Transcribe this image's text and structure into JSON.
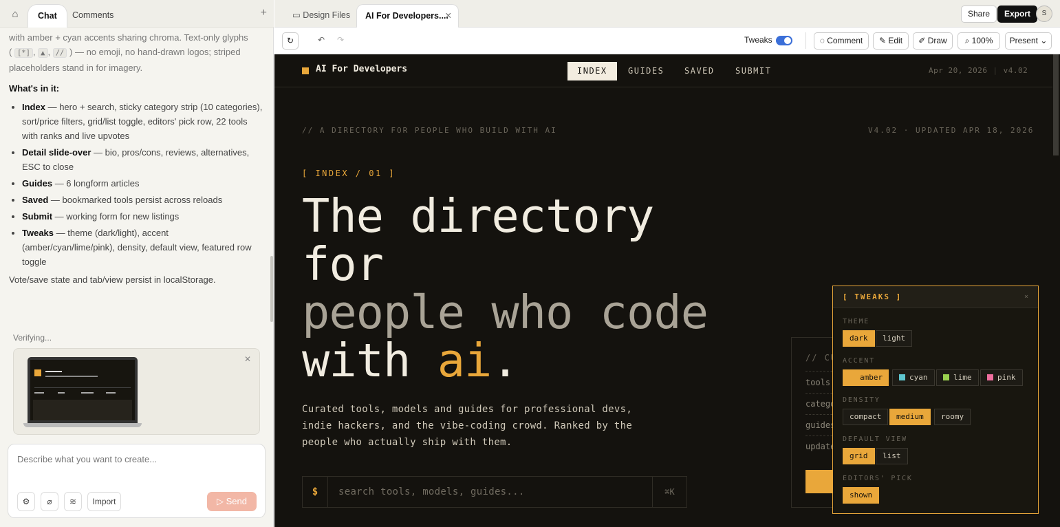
{
  "left_panel": {
    "tabs": {
      "chat": "Chat",
      "comments": "Comments"
    },
    "chat": {
      "intro_line1": "with amber + cyan accents sharing chroma. Text-only glyphs",
      "intro_open": "(",
      "glyph1": "[*]",
      "glyph2": "▲",
      "glyph3": "//",
      "intro_rest": ") — no emoji, no hand-drawn logos; striped placeholders stand in for imagery.",
      "heading": "What's in it:",
      "items": [
        {
          "title": "Index",
          "text": " — hero + search, sticky category strip (10 categories), sort/price filters, grid/list toggle, editors' pick row, 22 tools with ranks and live upvotes"
        },
        {
          "title": "Detail slide-over",
          "text": " — bio, pros/cons, reviews, alternatives, ESC to close"
        },
        {
          "title": "Guides",
          "text": " — 6 longform articles"
        },
        {
          "title": "Saved",
          "text": " — bookmarked tools persist across reloads"
        },
        {
          "title": "Submit",
          "text": " — working form for new listings"
        },
        {
          "title": "Tweaks",
          "text": " — theme (dark/light), accent (amber/cyan/lime/pink), density, default view, featured row toggle"
        }
      ],
      "footer": "Vote/save state and tab/view persist in localStorage."
    },
    "verifying": "Verifying...",
    "composer": {
      "placeholder": "Describe what you want to create...",
      "import": "Import",
      "send": "Send"
    }
  },
  "right_top": {
    "tabs": [
      "Design Files",
      "AI For Developers...."
    ],
    "share": "Share",
    "export": "Export",
    "avatar": "S"
  },
  "toolbar": {
    "tweaks": "Tweaks",
    "comment": "Comment",
    "edit": "Edit",
    "draw": "Draw",
    "zoom": "100%",
    "present": "Present"
  },
  "site": {
    "brand": "AI For Developers",
    "nav": [
      "INDEX",
      "GUIDES",
      "SAVED",
      "SUBMIT"
    ],
    "date": "Apr 20, 2026",
    "version": "v4.02",
    "eyebrow_left": "// A DIRECTORY FOR PEOPLE WHO BUILD WITH AI",
    "eyebrow_right": "V4.02 · UPDATED APR 18, 2026",
    "index_label": "[ INDEX / 01 ]",
    "headline": {
      "l1": "The directory",
      "l2": "for",
      "l3": "people who code",
      "l4a": "with ",
      "l4b": "ai",
      "l4c": "."
    },
    "lede": "Curated tools, models and guides for professional devs, indie hackers, and the vibe-coding crowd. Ranked by the people who actually ship with them.",
    "search": {
      "prompt": "$",
      "placeholder": "search tools, models, guides...",
      "shortcut": "⌘K"
    },
    "stats": {
      "title": "// CU",
      "rows": [
        "tools",
        "catego",
        "guides",
        "update"
      ]
    }
  },
  "tweaks_panel": {
    "title": "[ TWEAKS ]",
    "close": "×",
    "theme": {
      "label": "THEME",
      "options": [
        "dark",
        "light"
      ],
      "selected": "dark"
    },
    "accent": {
      "label": "ACCENT",
      "options": [
        "amber",
        "cyan",
        "lime",
        "pink"
      ],
      "selected": "amber",
      "colors": {
        "amber": "#e9a73a",
        "cyan": "#5ec6cf",
        "lime": "#9ad14f",
        "pink": "#ef6e9e"
      }
    },
    "density": {
      "label": "DENSITY",
      "options": [
        "compact",
        "medium",
        "roomy"
      ],
      "selected": "medium"
    },
    "default_view": {
      "label": "DEFAULT VIEW",
      "options": [
        "grid",
        "list"
      ],
      "selected": "grid"
    },
    "editors_pick": {
      "label": "EDITORS' PICK",
      "options": [
        "shown"
      ],
      "selected": "shown"
    }
  }
}
